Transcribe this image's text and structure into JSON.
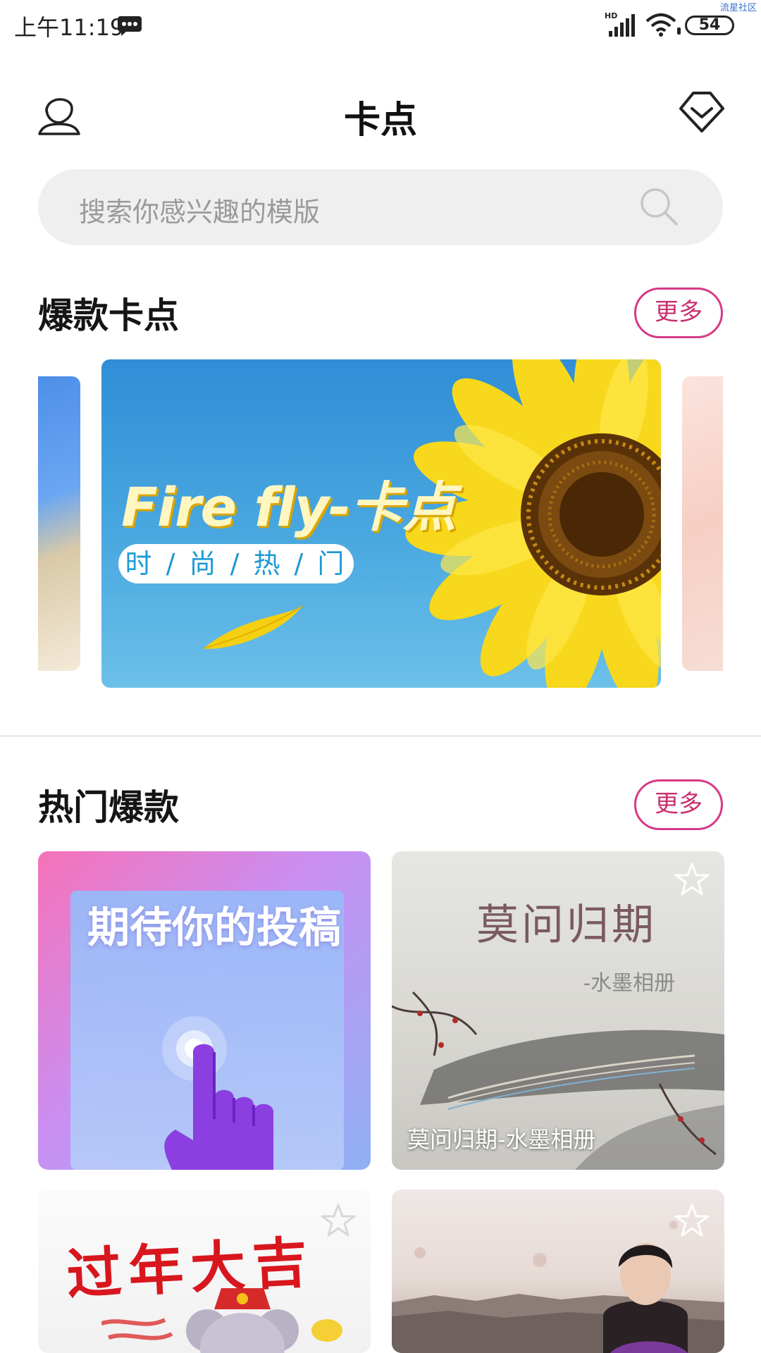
{
  "status_bar": {
    "time": "上午11:19",
    "network": "HD",
    "battery": "54",
    "watermark": "流星社区"
  },
  "header": {
    "title": "卡点",
    "left_icon": "profile-icon",
    "right_icon": "vip-diamond-icon"
  },
  "search": {
    "placeholder": "搜索你感兴趣的模版",
    "icon": "search-icon"
  },
  "sections": {
    "hot_beat": {
      "title": "爆款卡点",
      "more_label": "更多",
      "banner": {
        "title": "Fire fly-卡点",
        "tag": "时 / 尚 / 热 / 门"
      }
    },
    "popular": {
      "title": "热门爆款",
      "more_label": "更多",
      "cards": [
        {
          "overlay_text": "期待你的投稿"
        },
        {
          "art_title": "莫问归期",
          "art_subtitle": "-水墨相册",
          "caption": "莫问归期-水墨相册"
        },
        {
          "art_title": "过年大吉"
        },
        {
          "art_title": ""
        }
      ]
    }
  },
  "colors": {
    "accent": "#d63a86",
    "search_bg": "#efefef",
    "banner_blue": "#2f8ed6"
  }
}
